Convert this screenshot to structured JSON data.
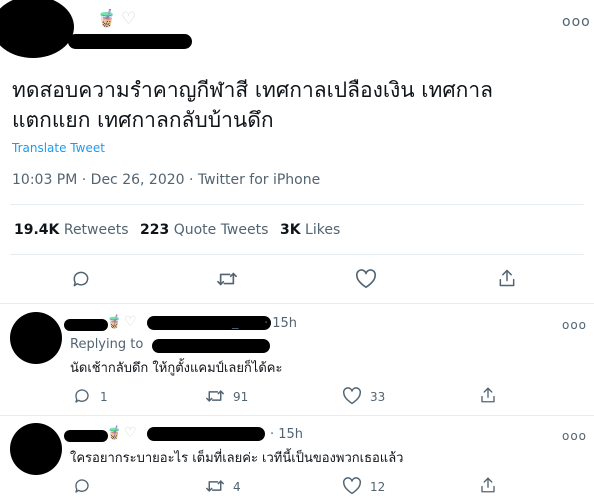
{
  "tweet": {
    "text_line1": "ทดสอบความรำคาญกีฬาสี เทศกาลเปลืองเงิน เทศกาล",
    "text_line2": "แตกแยก เทศกาลกลับบ้านดึก",
    "translate_label": "Translate Tweet",
    "meta": "10:03 PM · Dec 26, 2020 · Twitter for iPhone",
    "more_label": "ooo",
    "name_emoji": "🧋",
    "stats": {
      "retweets_num": "19.4K",
      "retweets_label": "Retweets",
      "quotes_num": "223",
      "quotes_label": "Quote Tweets",
      "likes_num": "3K",
      "likes_label": "Likes"
    }
  },
  "replies": [
    {
      "time": "· 15h",
      "underscore": "_",
      "replying_to": "Replying to",
      "text": "นัดเช้ากลับดึก ให้กูตั้งแคมป์เลยก็ได้คะ",
      "reply_count": "1",
      "retweet_count": "91",
      "like_count": "33",
      "name_emoji": "🧋",
      "more_label": "ooo"
    },
    {
      "time": "· 15h",
      "text": "ใครอยากระบายอะไร เต็มที่เลยค่ะ เวทีนี้เป็นของพวกเธอแล้ว",
      "reply_count": "",
      "retweet_count": "4",
      "like_count": "12",
      "name_emoji": "🧋",
      "more_label": "ooo"
    }
  ],
  "colors": {
    "link": "#1d9bf0",
    "muted": "#536471",
    "divider": "#e6ecf0"
  }
}
